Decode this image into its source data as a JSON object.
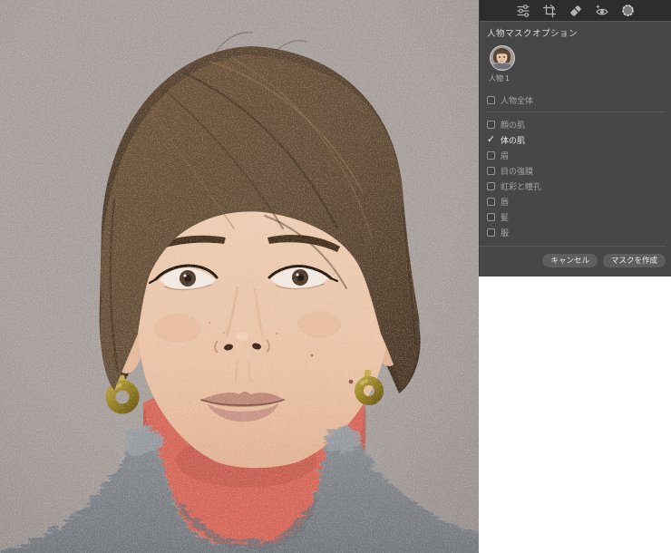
{
  "toolbar": {
    "icons": [
      {
        "name": "adjust-sliders-icon",
        "active": false
      },
      {
        "name": "crop-rotate-icon",
        "active": false
      },
      {
        "name": "healing-eraser-icon",
        "active": false
      },
      {
        "name": "red-eye-icon",
        "active": false
      },
      {
        "name": "masking-icon",
        "active": true
      }
    ]
  },
  "panel": {
    "title": "人物マスクオプション",
    "person": {
      "name": "人物 1"
    },
    "options": [
      {
        "label": "人物全体",
        "checked": false,
        "mark": ""
      },
      {
        "label": "顔の肌",
        "checked": false,
        "mark": ""
      },
      {
        "label": "体の肌",
        "checked": true,
        "mark": "✓"
      },
      {
        "label": "眉",
        "checked": false,
        "mark": ""
      },
      {
        "label": "目の強膜",
        "checked": false,
        "mark": ""
      },
      {
        "label": "虹彩と瞳孔",
        "checked": false,
        "mark": ""
      },
      {
        "label": "唇",
        "checked": false,
        "mark": ""
      },
      {
        "label": "髪",
        "checked": false,
        "mark": ""
      },
      {
        "label": "服",
        "checked": false,
        "mark": ""
      }
    ],
    "footer": {
      "cancel_label": "キャンセル",
      "create_label": "マスクを作成"
    }
  },
  "colors": {
    "panel_bg": "#474747",
    "toolbar_bg": "#2d2d2d",
    "mask_overlay": "#d5695b",
    "photo_bg": "#a8a09d"
  }
}
